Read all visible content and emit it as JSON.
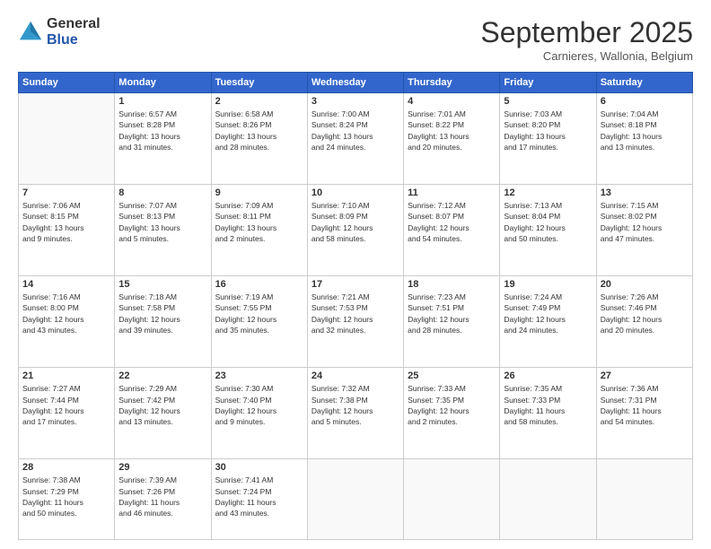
{
  "logo": {
    "general": "General",
    "blue": "Blue"
  },
  "title": "September 2025",
  "subtitle": "Carnieres, Wallonia, Belgium",
  "weekdays": [
    "Sunday",
    "Monday",
    "Tuesday",
    "Wednesday",
    "Thursday",
    "Friday",
    "Saturday"
  ],
  "weeks": [
    [
      {
        "day": "",
        "info": ""
      },
      {
        "day": "1",
        "info": "Sunrise: 6:57 AM\nSunset: 8:28 PM\nDaylight: 13 hours\nand 31 minutes."
      },
      {
        "day": "2",
        "info": "Sunrise: 6:58 AM\nSunset: 8:26 PM\nDaylight: 13 hours\nand 28 minutes."
      },
      {
        "day": "3",
        "info": "Sunrise: 7:00 AM\nSunset: 8:24 PM\nDaylight: 13 hours\nand 24 minutes."
      },
      {
        "day": "4",
        "info": "Sunrise: 7:01 AM\nSunset: 8:22 PM\nDaylight: 13 hours\nand 20 minutes."
      },
      {
        "day": "5",
        "info": "Sunrise: 7:03 AM\nSunset: 8:20 PM\nDaylight: 13 hours\nand 17 minutes."
      },
      {
        "day": "6",
        "info": "Sunrise: 7:04 AM\nSunset: 8:18 PM\nDaylight: 13 hours\nand 13 minutes."
      }
    ],
    [
      {
        "day": "7",
        "info": "Sunrise: 7:06 AM\nSunset: 8:15 PM\nDaylight: 13 hours\nand 9 minutes."
      },
      {
        "day": "8",
        "info": "Sunrise: 7:07 AM\nSunset: 8:13 PM\nDaylight: 13 hours\nand 5 minutes."
      },
      {
        "day": "9",
        "info": "Sunrise: 7:09 AM\nSunset: 8:11 PM\nDaylight: 13 hours\nand 2 minutes."
      },
      {
        "day": "10",
        "info": "Sunrise: 7:10 AM\nSunset: 8:09 PM\nDaylight: 12 hours\nand 58 minutes."
      },
      {
        "day": "11",
        "info": "Sunrise: 7:12 AM\nSunset: 8:07 PM\nDaylight: 12 hours\nand 54 minutes."
      },
      {
        "day": "12",
        "info": "Sunrise: 7:13 AM\nSunset: 8:04 PM\nDaylight: 12 hours\nand 50 minutes."
      },
      {
        "day": "13",
        "info": "Sunrise: 7:15 AM\nSunset: 8:02 PM\nDaylight: 12 hours\nand 47 minutes."
      }
    ],
    [
      {
        "day": "14",
        "info": "Sunrise: 7:16 AM\nSunset: 8:00 PM\nDaylight: 12 hours\nand 43 minutes."
      },
      {
        "day": "15",
        "info": "Sunrise: 7:18 AM\nSunset: 7:58 PM\nDaylight: 12 hours\nand 39 minutes."
      },
      {
        "day": "16",
        "info": "Sunrise: 7:19 AM\nSunset: 7:55 PM\nDaylight: 12 hours\nand 35 minutes."
      },
      {
        "day": "17",
        "info": "Sunrise: 7:21 AM\nSunset: 7:53 PM\nDaylight: 12 hours\nand 32 minutes."
      },
      {
        "day": "18",
        "info": "Sunrise: 7:23 AM\nSunset: 7:51 PM\nDaylight: 12 hours\nand 28 minutes."
      },
      {
        "day": "19",
        "info": "Sunrise: 7:24 AM\nSunset: 7:49 PM\nDaylight: 12 hours\nand 24 minutes."
      },
      {
        "day": "20",
        "info": "Sunrise: 7:26 AM\nSunset: 7:46 PM\nDaylight: 12 hours\nand 20 minutes."
      }
    ],
    [
      {
        "day": "21",
        "info": "Sunrise: 7:27 AM\nSunset: 7:44 PM\nDaylight: 12 hours\nand 17 minutes."
      },
      {
        "day": "22",
        "info": "Sunrise: 7:29 AM\nSunset: 7:42 PM\nDaylight: 12 hours\nand 13 minutes."
      },
      {
        "day": "23",
        "info": "Sunrise: 7:30 AM\nSunset: 7:40 PM\nDaylight: 12 hours\nand 9 minutes."
      },
      {
        "day": "24",
        "info": "Sunrise: 7:32 AM\nSunset: 7:38 PM\nDaylight: 12 hours\nand 5 minutes."
      },
      {
        "day": "25",
        "info": "Sunrise: 7:33 AM\nSunset: 7:35 PM\nDaylight: 12 hours\nand 2 minutes."
      },
      {
        "day": "26",
        "info": "Sunrise: 7:35 AM\nSunset: 7:33 PM\nDaylight: 11 hours\nand 58 minutes."
      },
      {
        "day": "27",
        "info": "Sunrise: 7:36 AM\nSunset: 7:31 PM\nDaylight: 11 hours\nand 54 minutes."
      }
    ],
    [
      {
        "day": "28",
        "info": "Sunrise: 7:38 AM\nSunset: 7:29 PM\nDaylight: 11 hours\nand 50 minutes."
      },
      {
        "day": "29",
        "info": "Sunrise: 7:39 AM\nSunset: 7:26 PM\nDaylight: 11 hours\nand 46 minutes."
      },
      {
        "day": "30",
        "info": "Sunrise: 7:41 AM\nSunset: 7:24 PM\nDaylight: 11 hours\nand 43 minutes."
      },
      {
        "day": "",
        "info": ""
      },
      {
        "day": "",
        "info": ""
      },
      {
        "day": "",
        "info": ""
      },
      {
        "day": "",
        "info": ""
      }
    ]
  ]
}
